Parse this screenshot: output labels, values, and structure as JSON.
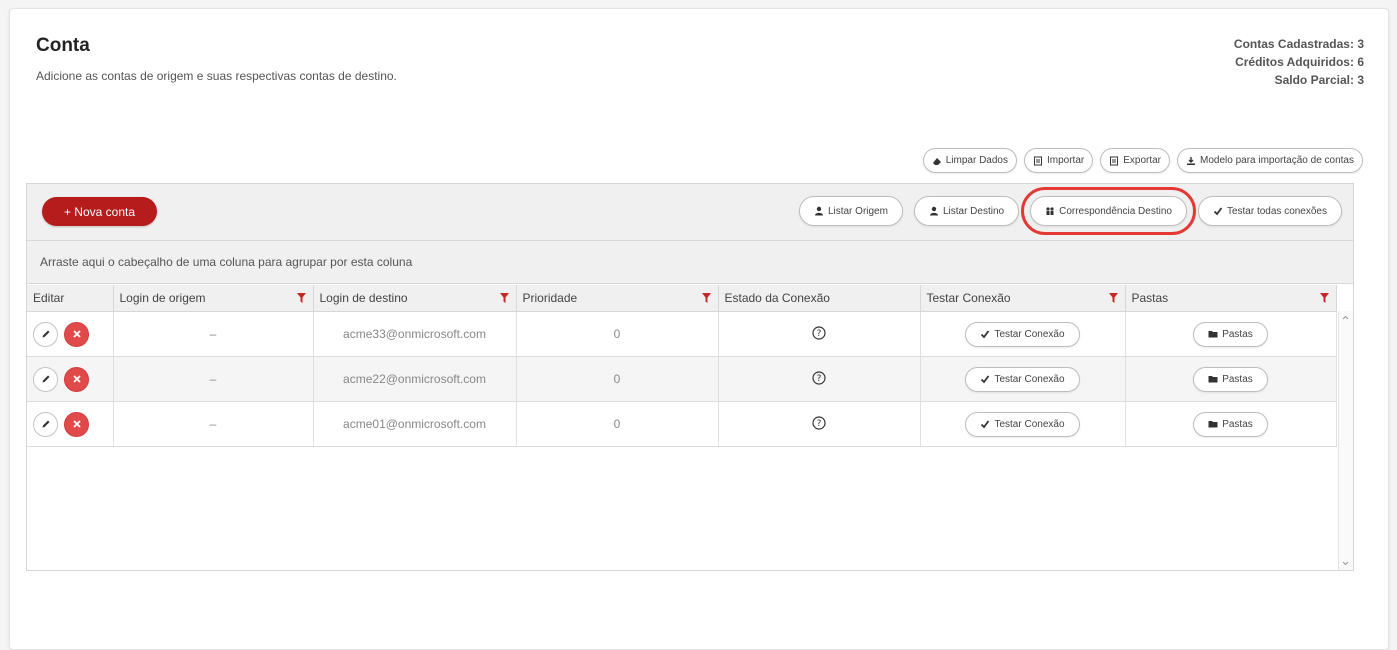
{
  "header": {
    "title": "Conta",
    "subtitle": "Adicione as contas de origem e suas respectivas contas de destino."
  },
  "stats": {
    "registered_label": "Contas Cadastradas:",
    "registered_value": "3",
    "credits_label": "Créditos Adquiridos:",
    "credits_value": "6",
    "balance_label": "Saldo Parcial:",
    "balance_value": "3"
  },
  "top_actions": {
    "clear": "Limpar Dados",
    "import": "Importar",
    "export": "Exportar",
    "template": "Modelo para importação de contas"
  },
  "toolbar": {
    "new_account": "+ Nova conta",
    "list_origin": "Listar Origem",
    "list_destination": "Listar Destino",
    "destination_match": "Correspondência Destino",
    "test_all": "Testar todas conexões"
  },
  "group_hint": "Arraste aqui o cabeçalho de uma coluna para agrupar por esta coluna",
  "columns": {
    "edit": "Editar",
    "origin": "Login de origem",
    "destination": "Login de destino",
    "priority": "Prioridade",
    "status": "Estado da Conexão",
    "test": "Testar Conexão",
    "folders": "Pastas"
  },
  "rows": [
    {
      "origin": "–",
      "destination": "acme33@onmicrosoft.com",
      "priority": "0",
      "status": "?",
      "test_label": "Testar Conexão",
      "folders_label": "Pastas"
    },
    {
      "origin": "–",
      "destination": "acme22@onmicrosoft.com",
      "priority": "0",
      "status": "?",
      "test_label": "Testar Conexão",
      "folders_label": "Pastas"
    },
    {
      "origin": "–",
      "destination": "acme01@onmicrosoft.com",
      "priority": "0",
      "status": "?",
      "test_label": "Testar Conexão",
      "folders_label": "Pastas"
    }
  ],
  "colors": {
    "primary_red": "#b71c1c",
    "delete_red": "#e04a4a",
    "highlight_red": "#e53935",
    "filter_red": "#c62828"
  }
}
